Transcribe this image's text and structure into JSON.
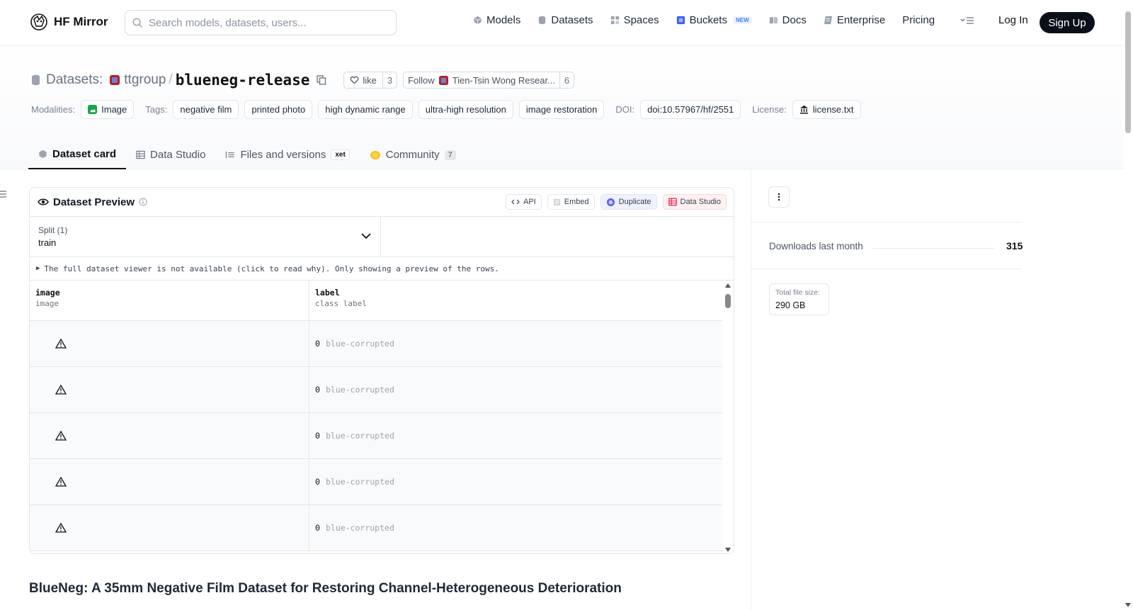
{
  "nav": {
    "logo_text": "HF Mirror",
    "search_placeholder": "Search models, datasets, users...",
    "links": [
      {
        "label": "Models",
        "icon": "cube-icon"
      },
      {
        "label": "Datasets",
        "icon": "database-icon"
      },
      {
        "label": "Spaces",
        "icon": "grid-icon"
      },
      {
        "label": "Buckets",
        "icon": "bucket-icon",
        "badge": "NEW"
      },
      {
        "label": "Docs",
        "icon": "book-icon"
      },
      {
        "label": "Enterprise",
        "icon": "enterprise-icon"
      },
      {
        "label": "Pricing"
      }
    ],
    "login": "Log In",
    "signup": "Sign Up"
  },
  "header": {
    "prefix": "Datasets:",
    "org": "ttgroup",
    "separator": "/",
    "name": "blueneg-release",
    "like_label": "like",
    "like_count": "3",
    "follow_label": "Follow",
    "follow_org": "Tien-Tsin Wong Resear...",
    "follow_count": "6"
  },
  "tags": {
    "modalities_label": "Modalities:",
    "modality": "Image",
    "tags_label": "Tags:",
    "items": [
      "negative film",
      "printed photo",
      "high dynamic range",
      "ultra-high resolution",
      "image restoration"
    ],
    "doi_label": "DOI:",
    "doi": "doi:10.57967/hf/2551",
    "license_label": "License:",
    "license": "license.txt"
  },
  "tabs": {
    "card": "Dataset card",
    "studio": "Data Studio",
    "files": "Files and versions",
    "xet": "xet",
    "community": "Community",
    "community_count": "7"
  },
  "preview": {
    "title": "Dataset Preview",
    "buttons": {
      "api": "API",
      "embed": "Embed",
      "duplicate": "Duplicate",
      "studio": "Data Studio"
    },
    "split_label": "Split (1)",
    "split_value": "train",
    "notice": "The full dataset viewer is not available (click to read why). Only showing a preview of the rows.",
    "columns": [
      {
        "name": "image",
        "type": "image"
      },
      {
        "name": "label",
        "type": "class label"
      }
    ],
    "rows": [
      {
        "label_num": "0",
        "label_text": "blue-corrupted"
      },
      {
        "label_num": "0",
        "label_text": "blue-corrupted"
      },
      {
        "label_num": "0",
        "label_text": "blue-corrupted"
      },
      {
        "label_num": "0",
        "label_text": "blue-corrupted"
      },
      {
        "label_num": "0",
        "label_text": "blue-corrupted"
      }
    ]
  },
  "readme": {
    "title": "BlueNeg: A 35mm Negative Film Dataset for Restoring Channel-Heterogeneous Deterioration"
  },
  "sidebar": {
    "downloads_label": "Downloads last month",
    "downloads_value": "315",
    "filesize_label": "Total file size:",
    "filesize_value": "290 GB"
  },
  "colors": {
    "accent_dark": "#0b0f19",
    "chip_border": "#e3e6ea",
    "warning_icon": "#111111"
  }
}
